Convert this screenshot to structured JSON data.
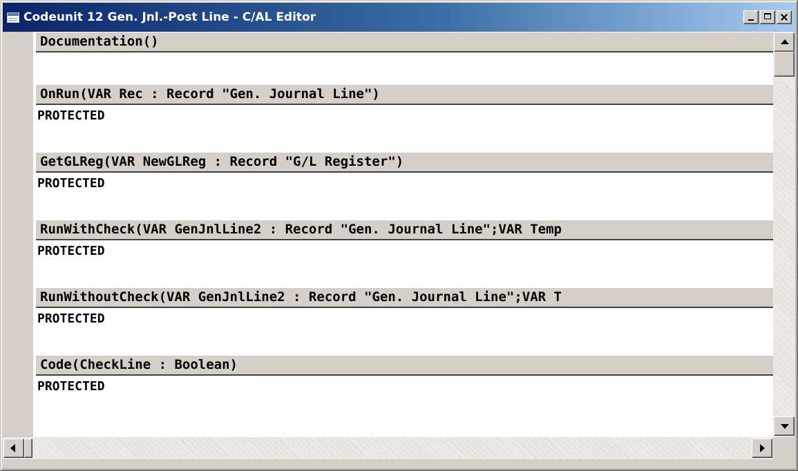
{
  "window": {
    "title": "Codeunit 12 Gen. Jnl.-Post Line - C/AL Editor",
    "icon": "table-icon",
    "controls": [
      "minimize-icon",
      "maximize-icon",
      "close-icon"
    ]
  },
  "sections": [
    {
      "header": "Documentation()",
      "body": ""
    },
    {
      "header": "OnRun(VAR Rec : Record \"Gen. Journal Line\")",
      "body": "PROTECTED"
    },
    {
      "header": "GetGLReg(VAR NewGLReg : Record \"G/L Register\")",
      "body": "PROTECTED"
    },
    {
      "header": "RunWithCheck(VAR GenJnlLine2 : Record \"Gen. Journal Line\";VAR Temp",
      "body": "PROTECTED"
    },
    {
      "header": "RunWithoutCheck(VAR GenJnlLine2 : Record \"Gen. Journal Line\";VAR T",
      "body": "PROTECTED"
    },
    {
      "header": "Code(CheckLine : Boolean)",
      "body": "PROTECTED"
    }
  ],
  "scrollbars": {
    "vertical": {
      "up_icon": "arrow-up-icon",
      "down_icon": "arrow-down-icon"
    },
    "horizontal": {
      "left_icon": "arrow-left-icon",
      "right_icon": "arrow-right-icon"
    }
  },
  "colors": {
    "title_gradient_start": "#0a246a",
    "title_gradient_end": "#a6caf0",
    "face": "#d4d0c8",
    "editor_bg": "#ffffff"
  }
}
